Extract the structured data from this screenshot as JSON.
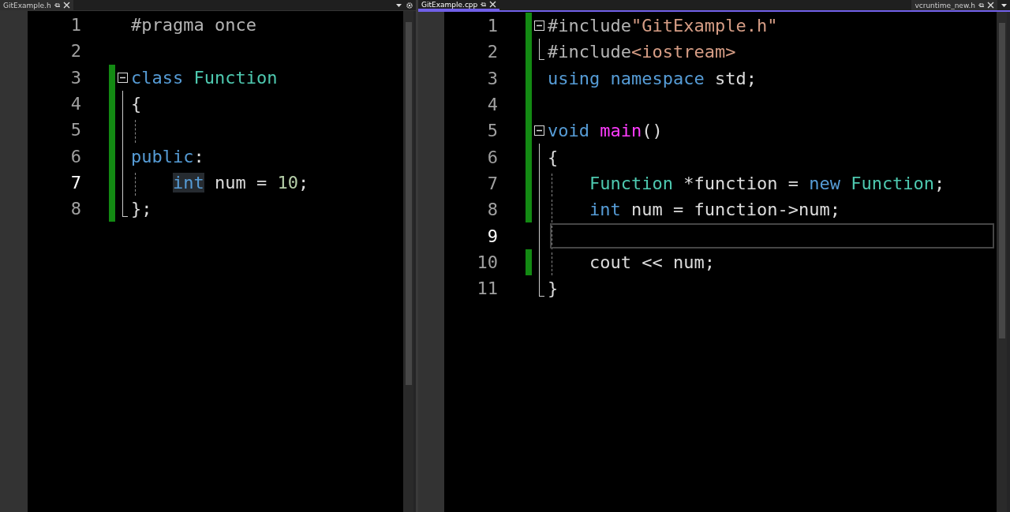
{
  "panes": [
    {
      "focused": false,
      "tabs": [
        {
          "label": "GitExample.h",
          "selected": false
        }
      ],
      "lines": [
        {
          "number": "1",
          "kind": "plain",
          "changed": false,
          "current": false,
          "guide": false,
          "tokens": [
            {
              "text": "#pragma once",
              "kind": "preproc"
            }
          ]
        },
        {
          "number": "2",
          "kind": "plain",
          "changed": false,
          "current": false,
          "guide": false
        },
        {
          "number": "3",
          "kind": "fold-start",
          "changed": true,
          "current": false,
          "guide": false,
          "tokens": [
            {
              "text": "class ",
              "kind": "keyword"
            },
            {
              "text": "Function",
              "kind": "type"
            }
          ]
        },
        {
          "number": "4",
          "kind": "fold-body",
          "changed": true,
          "current": false,
          "guide": false,
          "tokens": [
            {
              "text": "{",
              "kind": "plain"
            }
          ]
        },
        {
          "number": "5",
          "kind": "fold-body",
          "changed": true,
          "current": false,
          "guide": true
        },
        {
          "number": "6",
          "kind": "fold-body",
          "changed": true,
          "current": false,
          "guide": false,
          "tokens": [
            {
              "text": "public",
              "kind": "keyword"
            },
            {
              "text": ":",
              "kind": "plain"
            }
          ]
        },
        {
          "number": "7",
          "kind": "fold-body",
          "changed": true,
          "current": true,
          "guide": true,
          "indented": true,
          "tokens": [
            {
              "text": "int",
              "kind": "keyword",
              "highlighted": true
            },
            {
              "text": " num = ",
              "kind": "plain"
            },
            {
              "text": "10",
              "kind": "number"
            },
            {
              "text": ";",
              "kind": "plain"
            }
          ]
        },
        {
          "number": "8",
          "kind": "fold-end",
          "changed": true,
          "current": false,
          "guide": false,
          "tokens": [
            {
              "text": "};",
              "kind": "plain"
            }
          ]
        }
      ]
    },
    {
      "focused": true,
      "tabs": [
        {
          "label": "GitExample.cpp",
          "selected": true
        },
        {
          "label": "vcruntime_new.h",
          "selected": false
        }
      ],
      "lines": [
        {
          "number": "1",
          "kind": "fold-start",
          "changed": true,
          "current": false,
          "guide": false,
          "tokens": [
            {
              "text": "#include",
              "kind": "preproc"
            },
            {
              "text": "\"GitExample.h\"",
              "kind": "string"
            }
          ]
        },
        {
          "number": "2",
          "kind": "fold-end",
          "changed": true,
          "current": false,
          "guide": false,
          "tokens": [
            {
              "text": "#include",
              "kind": "preproc"
            },
            {
              "text": "<iostream>",
              "kind": "string"
            }
          ]
        },
        {
          "number": "3",
          "kind": "plain",
          "changed": true,
          "current": false,
          "guide": false,
          "tokens": [
            {
              "text": "using ",
              "kind": "keyword"
            },
            {
              "text": "namespace",
              "kind": "keyword"
            },
            {
              "text": " std;",
              "kind": "plain"
            }
          ]
        },
        {
          "number": "4",
          "kind": "plain",
          "changed": true,
          "current": false,
          "guide": false
        },
        {
          "number": "5",
          "kind": "fold-start",
          "changed": true,
          "current": false,
          "guide": false,
          "tokens": [
            {
              "text": "void ",
              "kind": "keyword"
            },
            {
              "text": "main",
              "kind": "function"
            },
            {
              "text": "()",
              "kind": "plain"
            }
          ]
        },
        {
          "number": "6",
          "kind": "fold-body",
          "changed": true,
          "current": false,
          "guide": false,
          "tokens": [
            {
              "text": "{",
              "kind": "plain"
            }
          ]
        },
        {
          "number": "7",
          "kind": "fold-body",
          "changed": true,
          "current": false,
          "guide": true,
          "indented": true,
          "tokens": [
            {
              "text": "Function",
              "kind": "type"
            },
            {
              "text": " *function = ",
              "kind": "plain"
            },
            {
              "text": "new ",
              "kind": "keyword"
            },
            {
              "text": "Function",
              "kind": "type"
            },
            {
              "text": ";",
              "kind": "plain"
            }
          ]
        },
        {
          "number": "8",
          "kind": "fold-body",
          "changed": true,
          "current": false,
          "guide": true,
          "indented": true,
          "tokens": [
            {
              "text": "int",
              "kind": "keyword"
            },
            {
              "text": " num = function->num;",
              "kind": "plain"
            }
          ]
        },
        {
          "number": "9",
          "kind": "fold-body",
          "changed": false,
          "current": true,
          "guide": true
        },
        {
          "number": "10",
          "kind": "fold-body",
          "changed": true,
          "current": false,
          "guide": true,
          "indented": true,
          "tokens": [
            {
              "text": "cout << num;",
              "kind": "plain"
            }
          ]
        },
        {
          "number": "11",
          "kind": "fold-end",
          "changed": false,
          "current": false,
          "guide": false,
          "tokens": [
            {
              "text": "}",
              "kind": "plain"
            }
          ]
        }
      ]
    }
  ]
}
